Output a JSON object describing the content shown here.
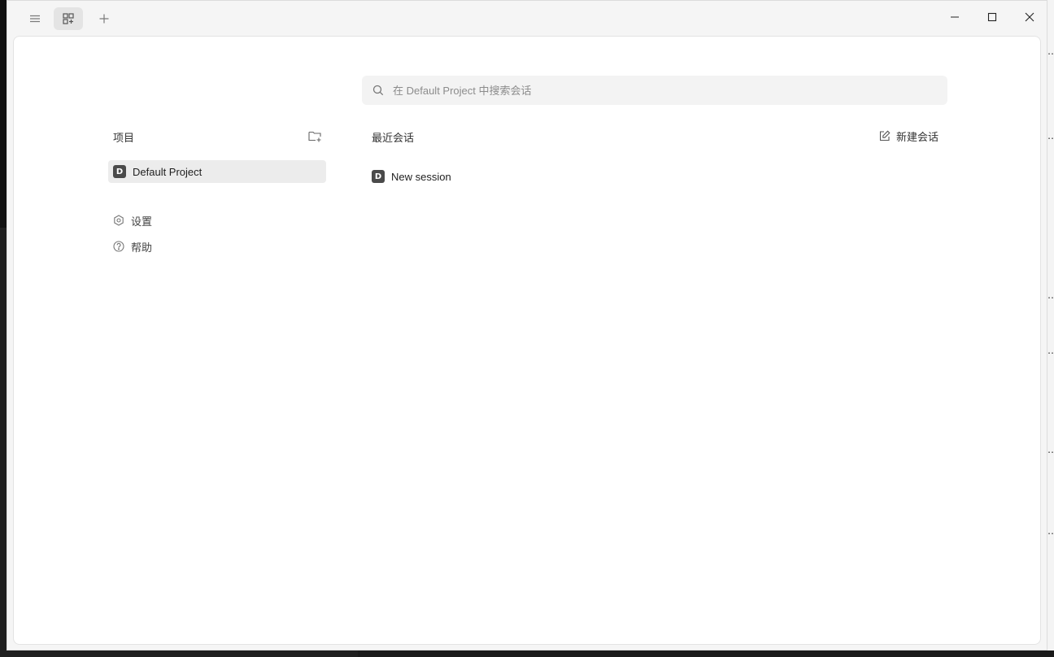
{
  "titlebar": {
    "menu_icon": "menu-icon",
    "tab_view_icon": "grid-plus-icon",
    "new_tab_icon": "plus-icon",
    "minimize_icon": "minimize-icon",
    "maximize_icon": "maximize-icon",
    "close_icon": "close-icon"
  },
  "search": {
    "placeholder": "在 Default Project 中搜索会话",
    "value": ""
  },
  "sidebar": {
    "projects_title": "项目",
    "new_project_icon": "folder-plus-icon",
    "projects": [
      {
        "initial": "D",
        "label": "Default Project",
        "selected": true
      }
    ],
    "links": [
      {
        "icon": "settings-icon",
        "label": "设置"
      },
      {
        "icon": "help-icon",
        "label": "帮助"
      }
    ]
  },
  "main": {
    "recent_title": "最近会话",
    "new_session_label": "新建会话",
    "sessions": [
      {
        "initial": "D",
        "label": "New session"
      }
    ]
  },
  "colors": {
    "window_bg": "#f5f5f5",
    "panel_bg": "#ffffff",
    "selected_bg": "#ececec",
    "avatar_bg": "#4a4a4a",
    "search_bg": "#f3f3f3"
  }
}
